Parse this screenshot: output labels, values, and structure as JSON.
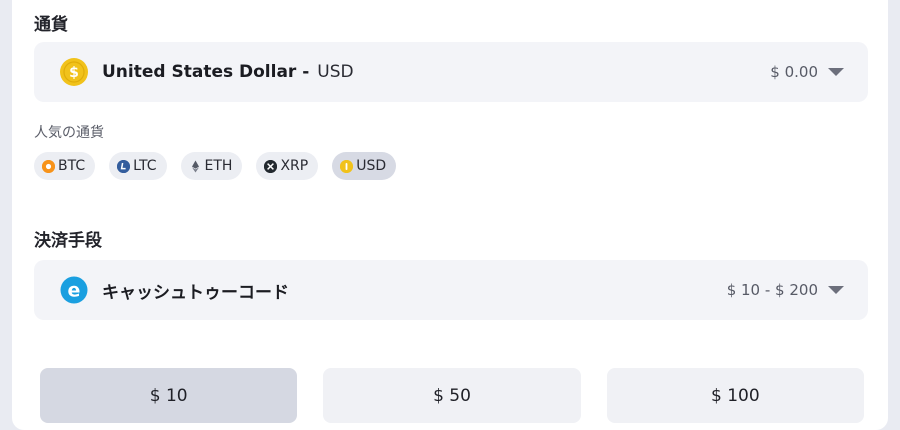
{
  "currency_section": {
    "title": "通貨",
    "selected_name": "United States Dollar -",
    "selected_code": "USD",
    "balance": "$ 0.00",
    "icon": "dollar-coin-icon",
    "icon_color": "#f1c21b"
  },
  "popular": {
    "title": "人気の通貨",
    "chips": [
      {
        "label": "BTC",
        "icon": "btc-icon",
        "color": "#f7931a",
        "active": false
      },
      {
        "label": "LTC",
        "icon": "ltc-icon",
        "color": "#345d9d",
        "active": false
      },
      {
        "label": "ETH",
        "icon": "eth-icon",
        "color": "#555a66",
        "active": false
      },
      {
        "label": "XRP",
        "icon": "xrp-icon",
        "color": "#23292f",
        "active": false
      },
      {
        "label": "USD",
        "icon": "usd-icon",
        "color": "#f1c21b",
        "active": true
      }
    ]
  },
  "payment_section": {
    "title": "決済手段",
    "method_name": "キャッシュトゥーコード",
    "range": "$ 10 - $ 200",
    "icon": "ecash-icon",
    "icon_color": "#1a9fe0"
  },
  "amounts": [
    {
      "label": "$ 10",
      "selected": true
    },
    {
      "label": "$ 50",
      "selected": false
    },
    {
      "label": "$ 100",
      "selected": false
    }
  ]
}
